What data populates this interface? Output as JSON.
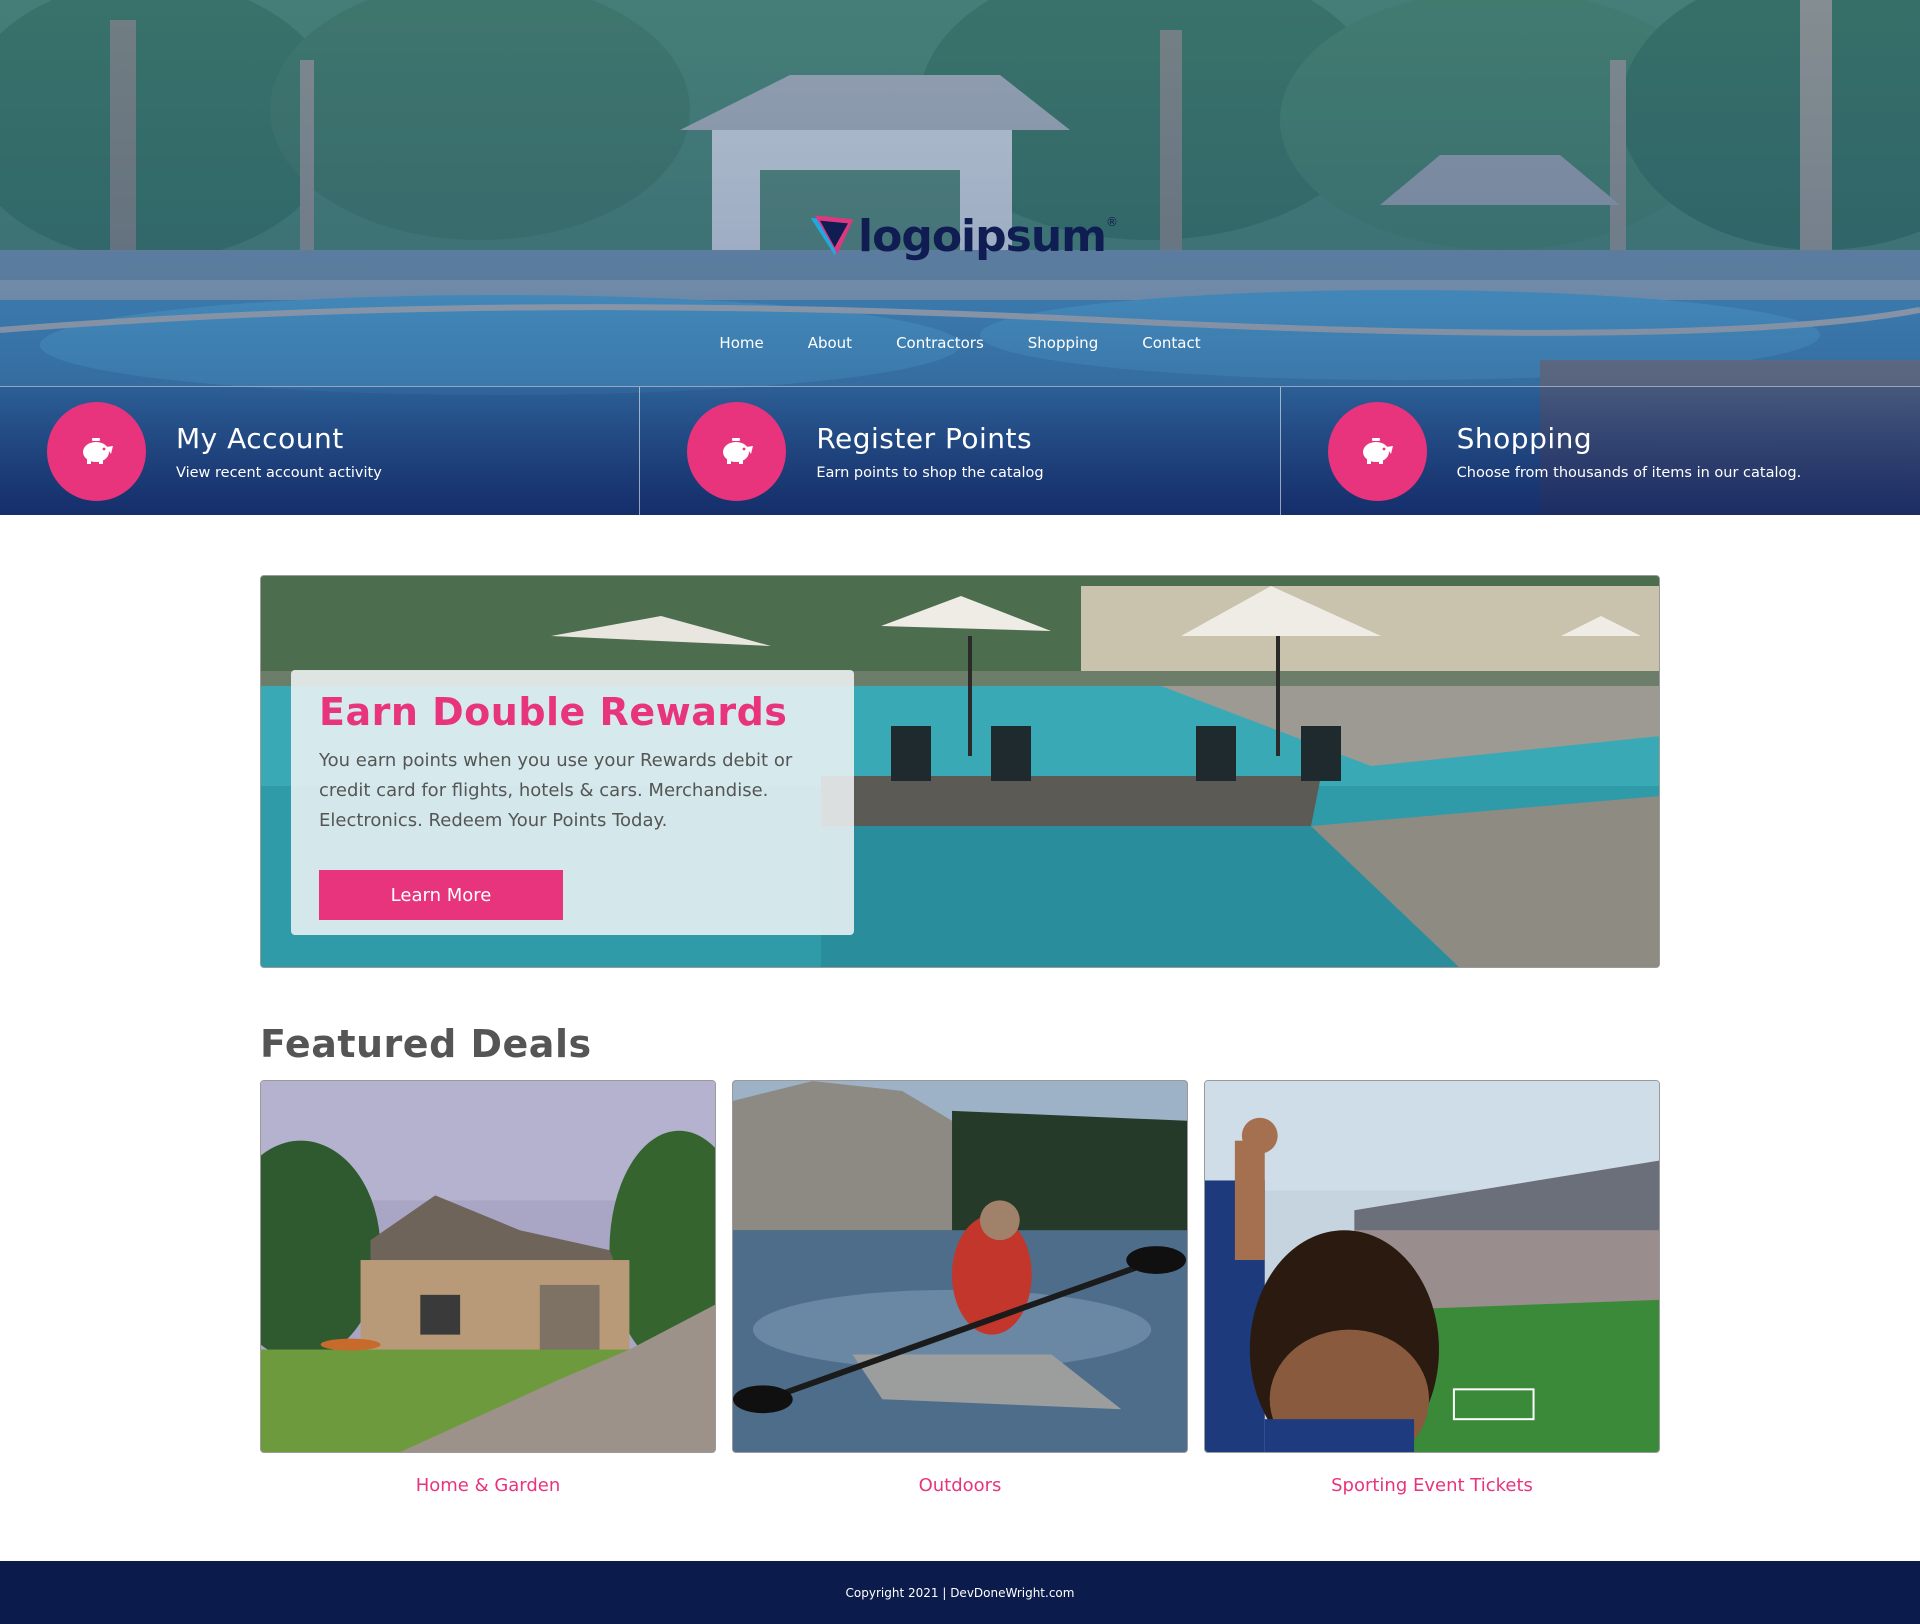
{
  "brand": {
    "logo_text": "logoipsum",
    "logo_reg": "®",
    "accent_color": "#e8337d",
    "navy_color": "#0b1b4b"
  },
  "nav": {
    "items": [
      {
        "label": "Home"
      },
      {
        "label": "About"
      },
      {
        "label": "Contractors"
      },
      {
        "label": "Shopping"
      },
      {
        "label": "Contact"
      }
    ]
  },
  "features": [
    {
      "icon": "piggy-bank-icon",
      "title": "My Account",
      "subtitle": "View recent account activity"
    },
    {
      "icon": "piggy-bank-icon",
      "title": "Register Points",
      "subtitle": "Earn points to shop the catalog"
    },
    {
      "icon": "piggy-bank-icon",
      "title": "Shopping",
      "subtitle": "Choose from thousands of items in our catalog."
    }
  ],
  "promo": {
    "title": "Earn Double Rewards",
    "body": "You earn points when you use your Rewards debit or credit card for flights, hotels & cars. Merchandise. Electronics. Redeem Your Points Today.",
    "button_label": "Learn More"
  },
  "deals": {
    "heading": "Featured Deals",
    "items": [
      {
        "label": "Home & Garden",
        "image": "house-photo"
      },
      {
        "label": "Outdoors",
        "image": "kayak-photo"
      },
      {
        "label": "Sporting Event Tickets",
        "image": "stadium-photo"
      }
    ]
  },
  "footer": {
    "copyright": "Copyright 2021 | DevDoneWright.com"
  }
}
